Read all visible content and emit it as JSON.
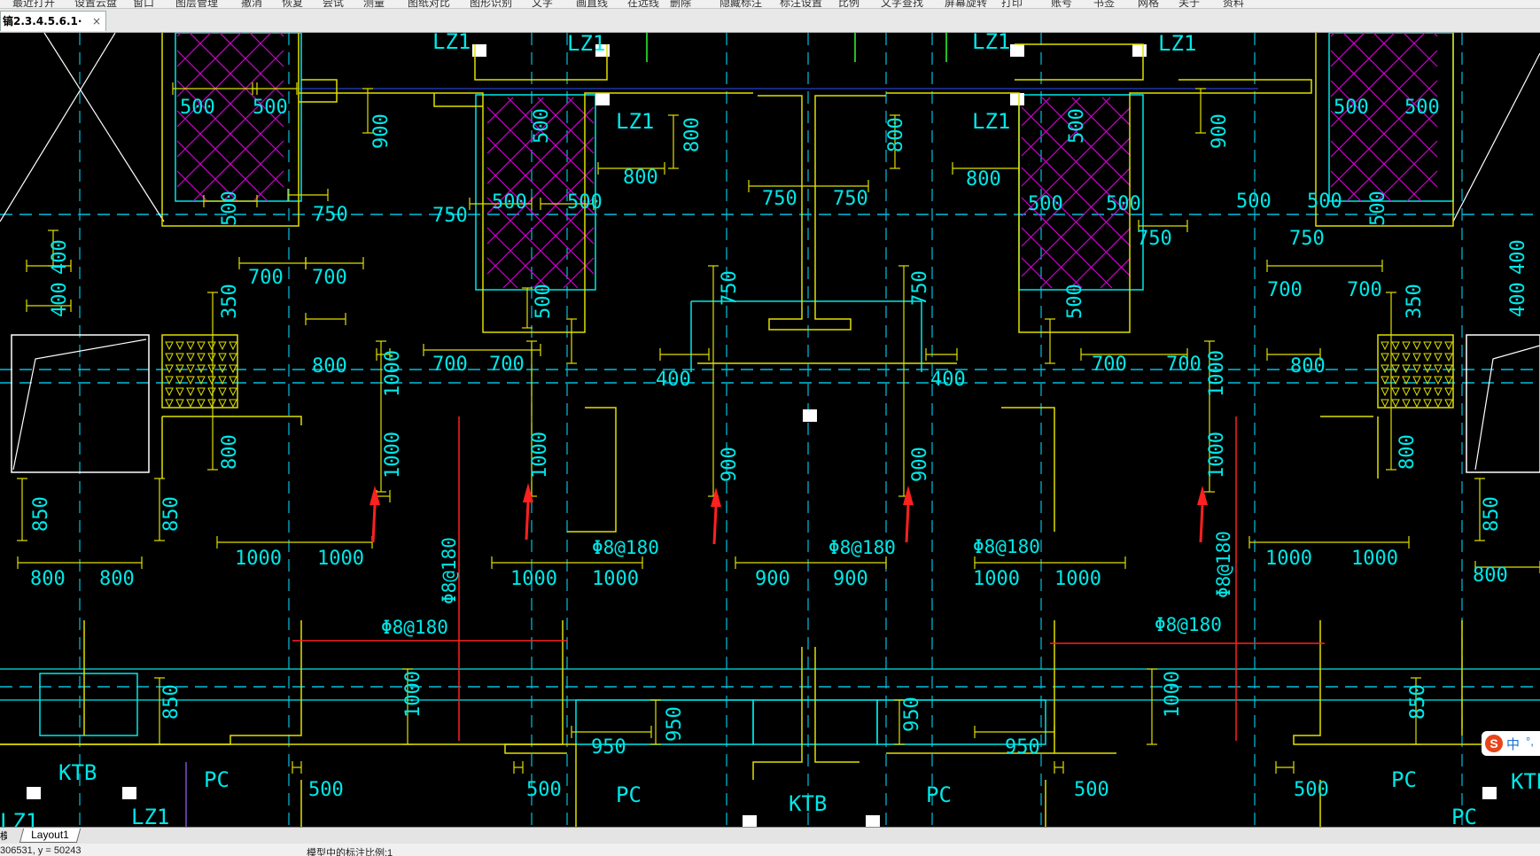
{
  "menu": [
    "最近打开",
    "设置云盘",
    "窗口",
    "图层管理",
    "撤消",
    "恢复",
    "尝试",
    "测量",
    "图纸对比",
    "图形识别",
    "文字",
    "画直线",
    "在远线",
    "删除",
    "隐藏标注",
    "标注设置",
    "比例",
    "文字查找",
    "屏幕旋转",
    "打印",
    "账号",
    "书签",
    "网格",
    "关于",
    "资料"
  ],
  "tab": {
    "title": "镐2.3.4.5.6.1·",
    "close": "×"
  },
  "bottom": {
    "model_label": "模型",
    "layout_tab": "Layout1"
  },
  "status": {
    "coords": "306531, y = 50243",
    "scale": "模型中的标注比例:1"
  },
  "ime": {
    "logo": "S",
    "lang": "中",
    "punct": "°,"
  },
  "drawing": {
    "colors": {
      "wall": "#e0e000",
      "dim": "#00e8e8",
      "axis": "#00c0e0",
      "hatch": "#d000d0",
      "rebar": "#ff2020",
      "white": "#ffffff"
    },
    "labels": [
      {
        "t": "LZ1"
      },
      {
        "t": "LZ1"
      },
      {
        "t": "LZ1"
      },
      {
        "t": "LZ1"
      },
      {
        "t": "LZ1"
      },
      {
        "t": "LZ1"
      },
      {
        "t": "LZ1"
      },
      {
        "t": "LZ1"
      },
      {
        "t": "KTB"
      },
      {
        "t": "KTB"
      },
      {
        "t": "KTB"
      },
      {
        "t": "PC"
      },
      {
        "t": "PC"
      },
      {
        "t": "PC"
      },
      {
        "t": "PC"
      },
      {
        "t": "PC"
      }
    ],
    "dims_h": [
      "500",
      "500",
      "500",
      "500",
      "500",
      "500",
      "500",
      "500",
      "500",
      "500",
      "750",
      "750",
      "750",
      "750",
      "750",
      "750",
      "800",
      "800",
      "800",
      "800",
      "700",
      "700",
      "700",
      "700",
      "700",
      "700",
      "700",
      "700",
      "400",
      "400",
      "1000",
      "1000",
      "1000",
      "1000",
      "1000",
      "1000",
      "1000",
      "1000",
      "900",
      "900",
      "800",
      "800",
      "800",
      "950",
      "950",
      "500",
      "500",
      "500",
      "500"
    ],
    "dims_v": [
      "900",
      "900",
      "800",
      "800",
      "500",
      "500",
      "500",
      "500",
      "500",
      "500",
      "400",
      "400",
      "400",
      "400",
      "350",
      "350",
      "750",
      "750",
      "1000",
      "1000",
      "1000",
      "1000",
      "1000",
      "900",
      "900",
      "800",
      "800",
      "850",
      "850",
      "850",
      "850",
      "950",
      "950",
      "1000",
      "1000",
      "850",
      "850"
    ],
    "rebar_labels": [
      "Φ8@180",
      "Φ8@180",
      "Φ8@180",
      "Φ8@180",
      "Φ8@180",
      "Φ8@180",
      "Φ8@180"
    ]
  }
}
